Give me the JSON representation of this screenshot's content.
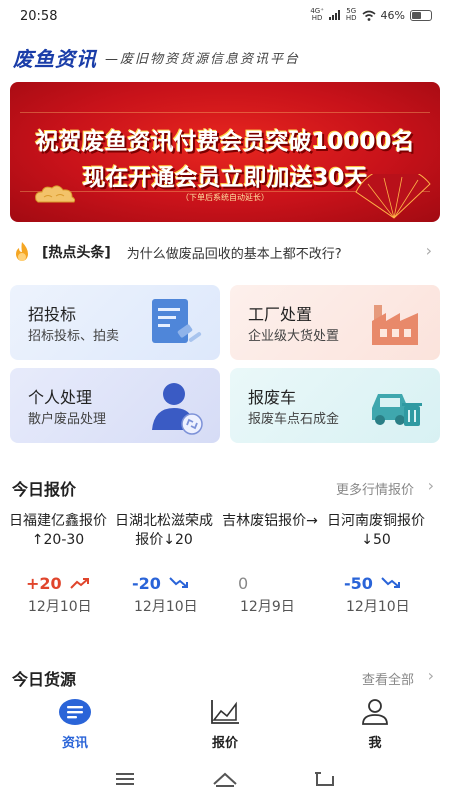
{
  "status_bar": {
    "time": "20:58",
    "net1_top": "4G⁺",
    "net1_bottom": "HD",
    "net2_top": "5G",
    "net2_bottom": "HD",
    "battery_text": "46%",
    "icons": [
      "signal-icon",
      "wifi-icon",
      "battery-icon"
    ]
  },
  "header": {
    "logo": "废鱼资讯",
    "slogan": "—废旧物资货源信息资讯平台"
  },
  "banner": {
    "line1": "祝贺废鱼资讯付费会员突破10000名",
    "line2": "现在开通会员立即加送30天",
    "note": "（下单后系统自动延长）",
    "colors": {
      "background": "#d0121a",
      "text": "#ffffff"
    }
  },
  "headline": {
    "tag": "[热点头条]",
    "text": "为什么做废品回收的基本上都不改行?",
    "icon": "flame-icon"
  },
  "categories": [
    {
      "title": "招投标",
      "subtitle": "招标投标、拍卖",
      "icon": "document-gavel-icon"
    },
    {
      "title": "工厂处置",
      "subtitle": "企业级大货处置",
      "icon": "factory-icon"
    },
    {
      "title": "个人处理",
      "subtitle": "散户废品处理",
      "icon": "person-recycle-icon"
    },
    {
      "title": "报废车",
      "subtitle": "报废车点石成金",
      "icon": "car-scrap-icon"
    }
  ],
  "quotes_section": {
    "title": "今日报价",
    "more": "更多行情报价",
    "items": [
      {
        "title": "日福建亿鑫报价↑20-30",
        "change": "+20",
        "direction": "up",
        "date": "12月10日"
      },
      {
        "title": "日湖北松滋荣成报价↓20",
        "change": "-20",
        "direction": "down",
        "date": "12月10日"
      },
      {
        "title": "吉林废铝报价→",
        "change": "0",
        "direction": "flat",
        "date": "12月9日"
      },
      {
        "title": "日河南废铜报价↓50",
        "change": "-50",
        "direction": "down",
        "date": "12月10日"
      }
    ]
  },
  "supply_section": {
    "title": "今日货源",
    "more": "查看全部"
  },
  "tabbar": {
    "tabs": [
      {
        "label": "资讯",
        "icon": "news-icon",
        "active": true
      },
      {
        "label": "报价",
        "icon": "chart-icon",
        "active": false
      },
      {
        "label": "我",
        "icon": "user-icon",
        "active": false
      }
    ],
    "active_color": "#2a64d8"
  },
  "navbar": {
    "icons": [
      "menu-icon",
      "home-icon",
      "back-icon"
    ]
  }
}
